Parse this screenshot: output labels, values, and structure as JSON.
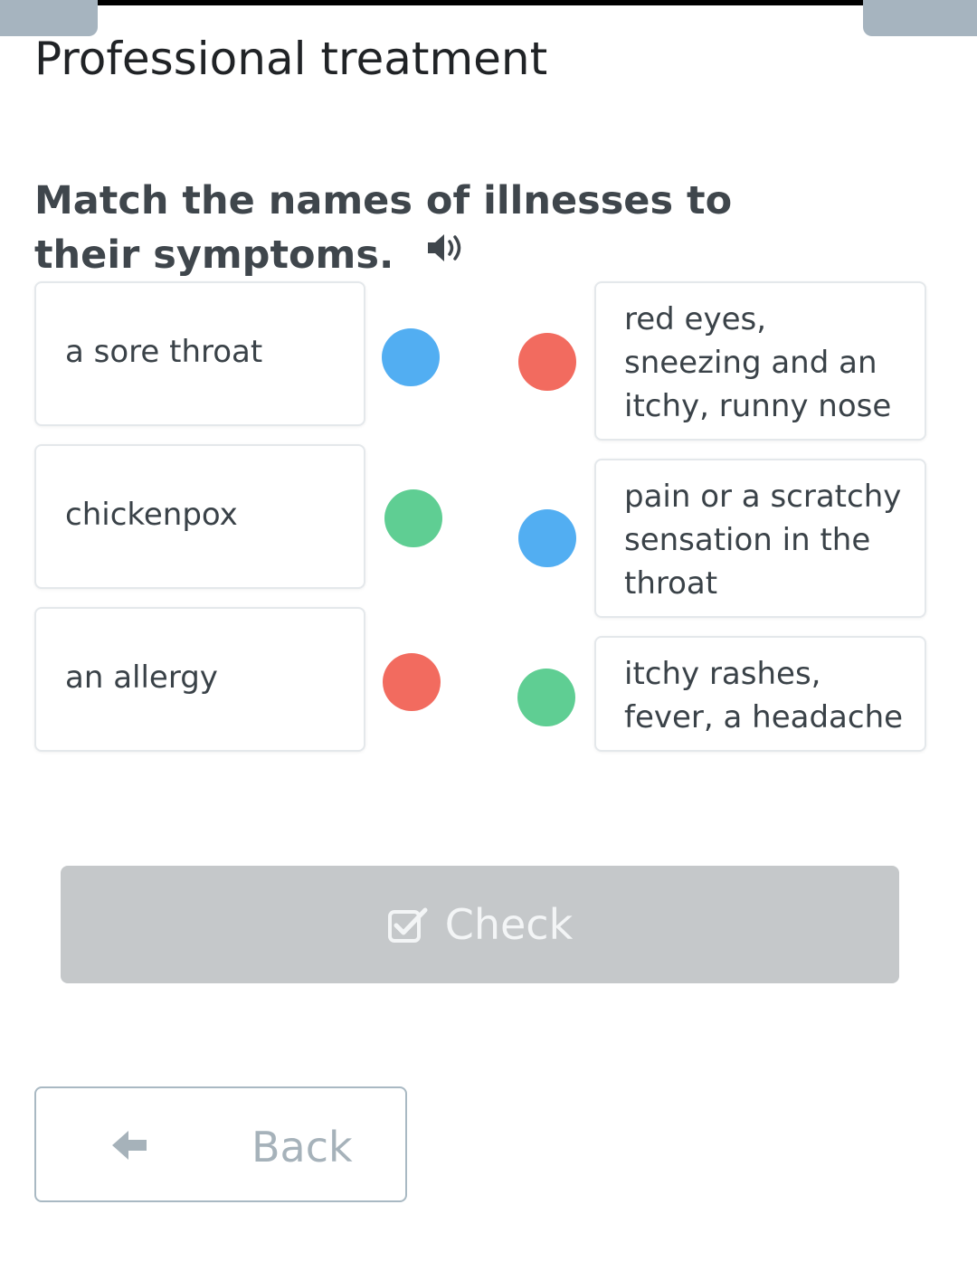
{
  "header": {
    "title": "Professional treatment"
  },
  "exercise": {
    "instruction": "Match the names of illnesses to their symptoms.",
    "illnesses": [
      {
        "label": "a sore throat",
        "dot_color": "#52aef2"
      },
      {
        "label": "chickenpox",
        "dot_color": "#5fce93"
      },
      {
        "label": "an allergy",
        "dot_color": "#f26b5f"
      }
    ],
    "symptoms": [
      {
        "label": "red eyes, sneezing and an itchy, runny nose",
        "dot_color": "#f26b5f"
      },
      {
        "label": "pain or a scratchy sensation in the throat",
        "dot_color": "#52aef2"
      },
      {
        "label": "itchy rashes, fever, a headache",
        "dot_color": "#5fce93"
      }
    ]
  },
  "actions": {
    "check_label": "Check",
    "back_label": "Back"
  },
  "icons": {
    "audio": "speaker-icon",
    "check": "checkbox-check-icon",
    "back": "arrow-left-icon"
  },
  "colors": {
    "blue": "#52aef2",
    "green": "#5fce93",
    "red": "#f26b5f",
    "check_button": "#c5c8ca",
    "back_border": "#a9b9c3"
  }
}
